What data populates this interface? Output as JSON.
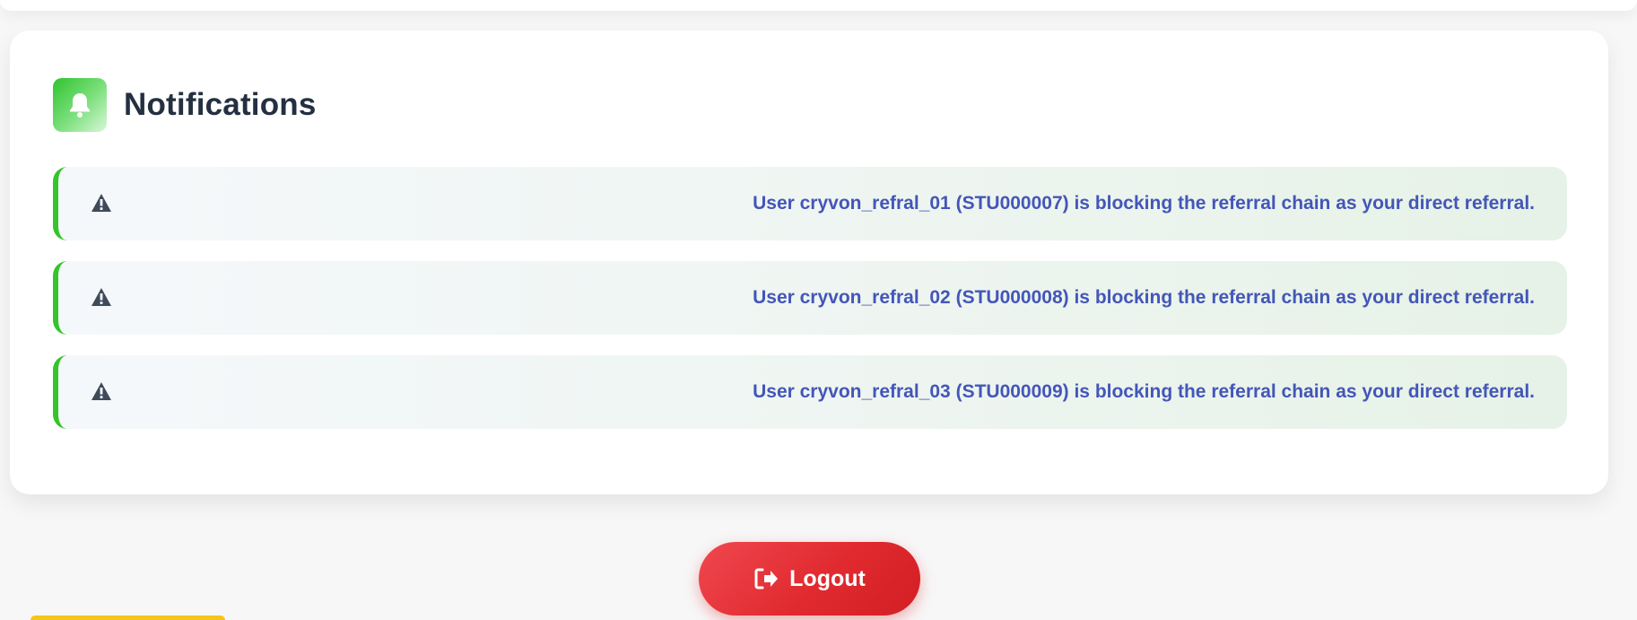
{
  "notifications_panel": {
    "title": "Notifications",
    "header_icon": "bell-icon",
    "accent_color": "#35c42b",
    "items": [
      {
        "icon": "warning-icon",
        "message": "User cryvon_refral_01 (STU000007) is blocking the referral chain as your direct referral."
      },
      {
        "icon": "warning-icon",
        "message": "User cryvon_refral_02 (STU000008) is blocking the referral chain as your direct referral."
      },
      {
        "icon": "warning-icon",
        "message": "User cryvon_refral_03 (STU000009) is blocking the referral chain as your direct referral."
      }
    ]
  },
  "logout": {
    "label": "Logout",
    "icon": "sign-out-icon",
    "color": "#e02a2f"
  }
}
